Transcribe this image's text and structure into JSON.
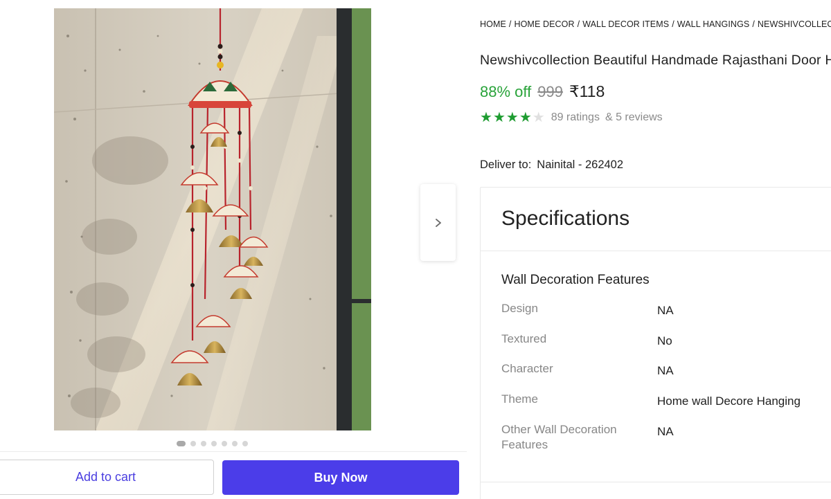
{
  "breadcrumb": {
    "items": [
      "HOME",
      "HOME DECOR",
      "WALL DECOR ITEMS",
      "WALL HANGINGS",
      "NEWSHIVCOLLECTION WALL HANGINGS"
    ],
    "separator": "/"
  },
  "product": {
    "title": "Newshivcollection Beautiful Handmade Rajasthani Door Hanging Wind Chimes",
    "discount": "88% off",
    "mrp": "999",
    "price": "₹118",
    "rating_stars": 4,
    "ratings_text": "89 ratings",
    "reviews_text": "& 5 reviews"
  },
  "delivery": {
    "label": "Deliver to:",
    "location": "Nainital - 262402"
  },
  "gallery": {
    "dot_count": 7,
    "active_index": 0,
    "next_icon": "chevron-right-icon"
  },
  "actions": {
    "add_to_cart": "Add to cart",
    "buy_now": "Buy Now"
  },
  "specifications": {
    "title": "Specifications",
    "section_title": "Wall Decoration Features",
    "rows": [
      {
        "key": "Design",
        "value": "NA"
      },
      {
        "key": "Textured",
        "value": "No"
      },
      {
        "key": "Character",
        "value": "NA"
      },
      {
        "key": "Theme",
        "value": "Home wall Decore Hanging"
      },
      {
        "key": "Other Wall Decoration Features",
        "value": "NA"
      }
    ]
  },
  "colors": {
    "brand": "#4b3de9",
    "discount_green": "#29a33a",
    "star_green": "#1e9c31"
  }
}
